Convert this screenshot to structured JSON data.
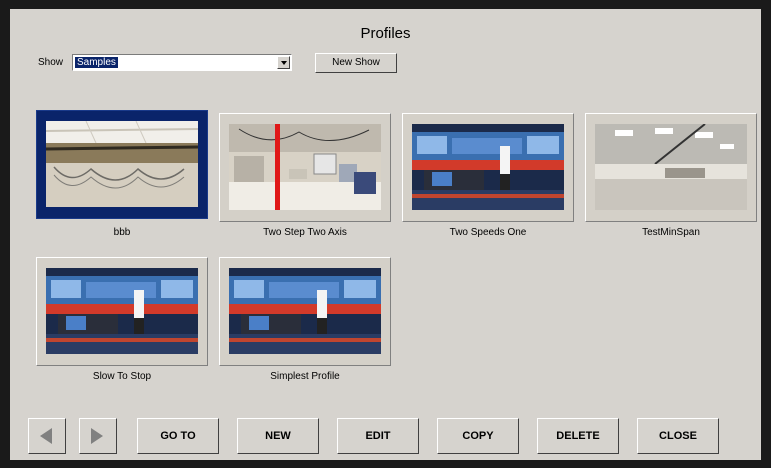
{
  "title": "Profiles",
  "show": {
    "label": "Show",
    "value": "Samples"
  },
  "new_show_label": "New Show",
  "profiles": [
    {
      "name": "bbb",
      "scene": "ceiling-rig",
      "selected": true
    },
    {
      "name": "Two Step Two Axis",
      "scene": "lab-room"
    },
    {
      "name": "Two Speeds One",
      "scene": "news-studio"
    },
    {
      "name": "TestMinSpan",
      "scene": "office-ceiling"
    },
    {
      "name": "Slow To Stop",
      "scene": "news-studio"
    },
    {
      "name": "Simplest Profile",
      "scene": "news-studio"
    }
  ],
  "buttons": {
    "goto": "GO TO",
    "new": "NEW",
    "edit": "EDIT",
    "copy": "COPY",
    "delete": "DELETE",
    "close": "CLOSE"
  },
  "nav_icons": {
    "prev": "triangle-left-icon",
    "next": "triangle-right-icon"
  }
}
